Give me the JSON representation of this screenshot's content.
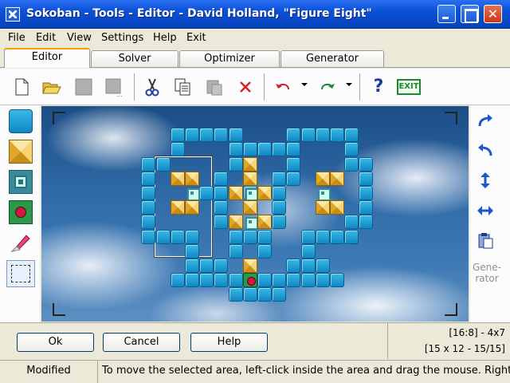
{
  "window": {
    "title": "Sokoban - Tools - Editor - David Holland, \"Figure Eight\""
  },
  "menu": [
    "File",
    "Edit",
    "View",
    "Settings",
    "Help",
    "Exit"
  ],
  "tabs": [
    "Editor",
    "Solver",
    "Optimizer",
    "Generator"
  ],
  "toolbar": {
    "icons": [
      "new-file-icon",
      "open-folder-icon",
      "save-icon",
      "save-as-icon",
      "cut-icon",
      "copy-icon",
      "paste-icon",
      "delete-icon",
      "undo-icon",
      "redo-icon",
      "help-icon",
      "exit-icon"
    ],
    "exit_label": "EXIT",
    "help_label": "?"
  },
  "palette": [
    "wall-tool",
    "box-tool",
    "goal-tool",
    "player-tool",
    "eraser-tool",
    "select-tool"
  ],
  "right_panel": {
    "generator_label": "Gene-rator"
  },
  "board": {
    "walls": [
      [
        9,
        1
      ],
      [
        10,
        1
      ],
      [
        11,
        1
      ],
      [
        12,
        1
      ],
      [
        13,
        1
      ],
      [
        17,
        1
      ],
      [
        18,
        1
      ],
      [
        19,
        1
      ],
      [
        20,
        1
      ],
      [
        21,
        1
      ],
      [
        9,
        2
      ],
      [
        13,
        2
      ],
      [
        14,
        2
      ],
      [
        15,
        2
      ],
      [
        16,
        2
      ],
      [
        17,
        2
      ],
      [
        21,
        2
      ],
      [
        7,
        3
      ],
      [
        8,
        3
      ],
      [
        13,
        3
      ],
      [
        17,
        3
      ],
      [
        21,
        3
      ],
      [
        22,
        3
      ],
      [
        7,
        4
      ],
      [
        12,
        4
      ],
      [
        16,
        4
      ],
      [
        17,
        4
      ],
      [
        22,
        4
      ],
      [
        7,
        5
      ],
      [
        11,
        5
      ],
      [
        12,
        5
      ],
      [
        14,
        5
      ],
      [
        16,
        5
      ],
      [
        22,
        5
      ],
      [
        7,
        6
      ],
      [
        12,
        6
      ],
      [
        16,
        6
      ],
      [
        22,
        6
      ],
      [
        7,
        7
      ],
      [
        12,
        7
      ],
      [
        16,
        7
      ],
      [
        21,
        7
      ],
      [
        22,
        7
      ],
      [
        7,
        8
      ],
      [
        8,
        8
      ],
      [
        9,
        8
      ],
      [
        10,
        8
      ],
      [
        13,
        8
      ],
      [
        14,
        8
      ],
      [
        15,
        8
      ],
      [
        18,
        8
      ],
      [
        19,
        8
      ],
      [
        20,
        8
      ],
      [
        21,
        8
      ],
      [
        10,
        9
      ],
      [
        13,
        9
      ],
      [
        15,
        9
      ],
      [
        18,
        9
      ],
      [
        10,
        10
      ],
      [
        11,
        10
      ],
      [
        12,
        10
      ],
      [
        14,
        10
      ],
      [
        17,
        10
      ],
      [
        18,
        10
      ],
      [
        10,
        11
      ],
      [
        11,
        11
      ],
      [
        12,
        11
      ],
      [
        13,
        11
      ],
      [
        15,
        11
      ],
      [
        16,
        11
      ],
      [
        17,
        11
      ],
      [
        18,
        11
      ],
      [
        19,
        11
      ],
      [
        20,
        11
      ],
      [
        13,
        12
      ],
      [
        14,
        12
      ],
      [
        15,
        12
      ],
      [
        16,
        12
      ],
      [
        20,
        11
      ],
      [
        19,
        10
      ],
      [
        10,
        11
      ],
      [
        9,
        11
      ]
    ],
    "boxes": [
      [
        9,
        4
      ],
      [
        10,
        4
      ],
      [
        9,
        6
      ],
      [
        10,
        6
      ],
      [
        14,
        4
      ],
      [
        13,
        5
      ],
      [
        15,
        5
      ],
      [
        14,
        6
      ],
      [
        13,
        7
      ],
      [
        15,
        7
      ],
      [
        19,
        4
      ],
      [
        20,
        4
      ],
      [
        19,
        6
      ],
      [
        20,
        6
      ],
      [
        14,
        3
      ],
      [
        14,
        10
      ]
    ],
    "goals": [
      [
        10,
        5
      ],
      [
        14,
        4
      ],
      [
        14,
        5
      ],
      [
        14,
        6
      ],
      [
        14,
        7
      ],
      [
        19,
        5
      ]
    ],
    "player": [
      14,
      11
    ]
  },
  "buttons": {
    "ok": "Ok",
    "cancel": "Cancel",
    "help": "Help"
  },
  "info": {
    "line1": "[16:8] - 4x7",
    "line2": "[15 x 12 - 15/15]"
  },
  "status": {
    "state": "Modified",
    "message": "To move the selected area, left-click inside the area and drag the mouse.  Right-cli"
  }
}
